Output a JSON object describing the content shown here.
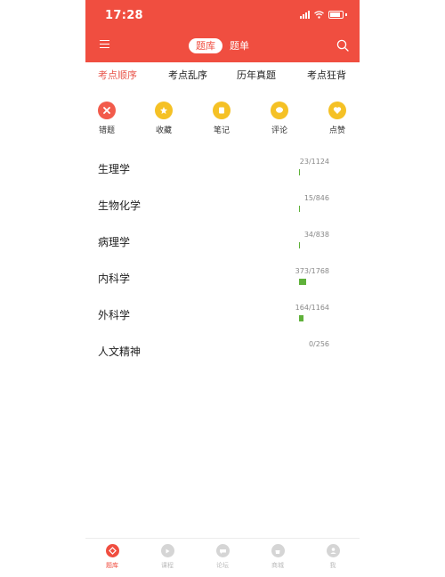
{
  "status_bar": {
    "time": "17:28"
  },
  "header": {
    "tab_active": "题库",
    "tab_second": "题单"
  },
  "category_tabs": [
    {
      "label": "考点顺序",
      "active": true
    },
    {
      "label": "考点乱序",
      "active": false
    },
    {
      "label": "历年真题",
      "active": false
    },
    {
      "label": "考点狂背",
      "active": false
    }
  ],
  "features": [
    {
      "label": "错题",
      "icon": "x-icon",
      "color": "#f25b4b"
    },
    {
      "label": "收藏",
      "icon": "favorite-icon",
      "color": "#f5c125"
    },
    {
      "label": "笔记",
      "icon": "note-icon",
      "color": "#f5c125"
    },
    {
      "label": "评论",
      "icon": "comment-icon",
      "color": "#f5c125"
    },
    {
      "label": "点赞",
      "icon": "like-icon",
      "color": "#f5c125"
    }
  ],
  "subjects": [
    {
      "name": "生理学",
      "progress_text": "23/1124",
      "progress": 0.02
    },
    {
      "name": "生物化学",
      "progress_text": "15/846",
      "progress": 0.018
    },
    {
      "name": "病理学",
      "progress_text": "34/838",
      "progress": 0.041
    },
    {
      "name": "内科学",
      "progress_text": "373/1768",
      "progress": 0.211
    },
    {
      "name": "外科学",
      "progress_text": "164/1164",
      "progress": 0.141
    },
    {
      "name": "人文精神",
      "progress_text": "0/256",
      "progress": 0
    }
  ],
  "bottom_nav": [
    {
      "label": "题库",
      "active": true
    },
    {
      "label": "课程",
      "active": false
    },
    {
      "label": "论坛",
      "active": false
    },
    {
      "label": "商城",
      "active": false
    },
    {
      "label": "我",
      "active": false
    }
  ],
  "colors": {
    "brand": "#f04e40",
    "progress": "#5fb13a",
    "feature_yellow": "#f5c125"
  }
}
